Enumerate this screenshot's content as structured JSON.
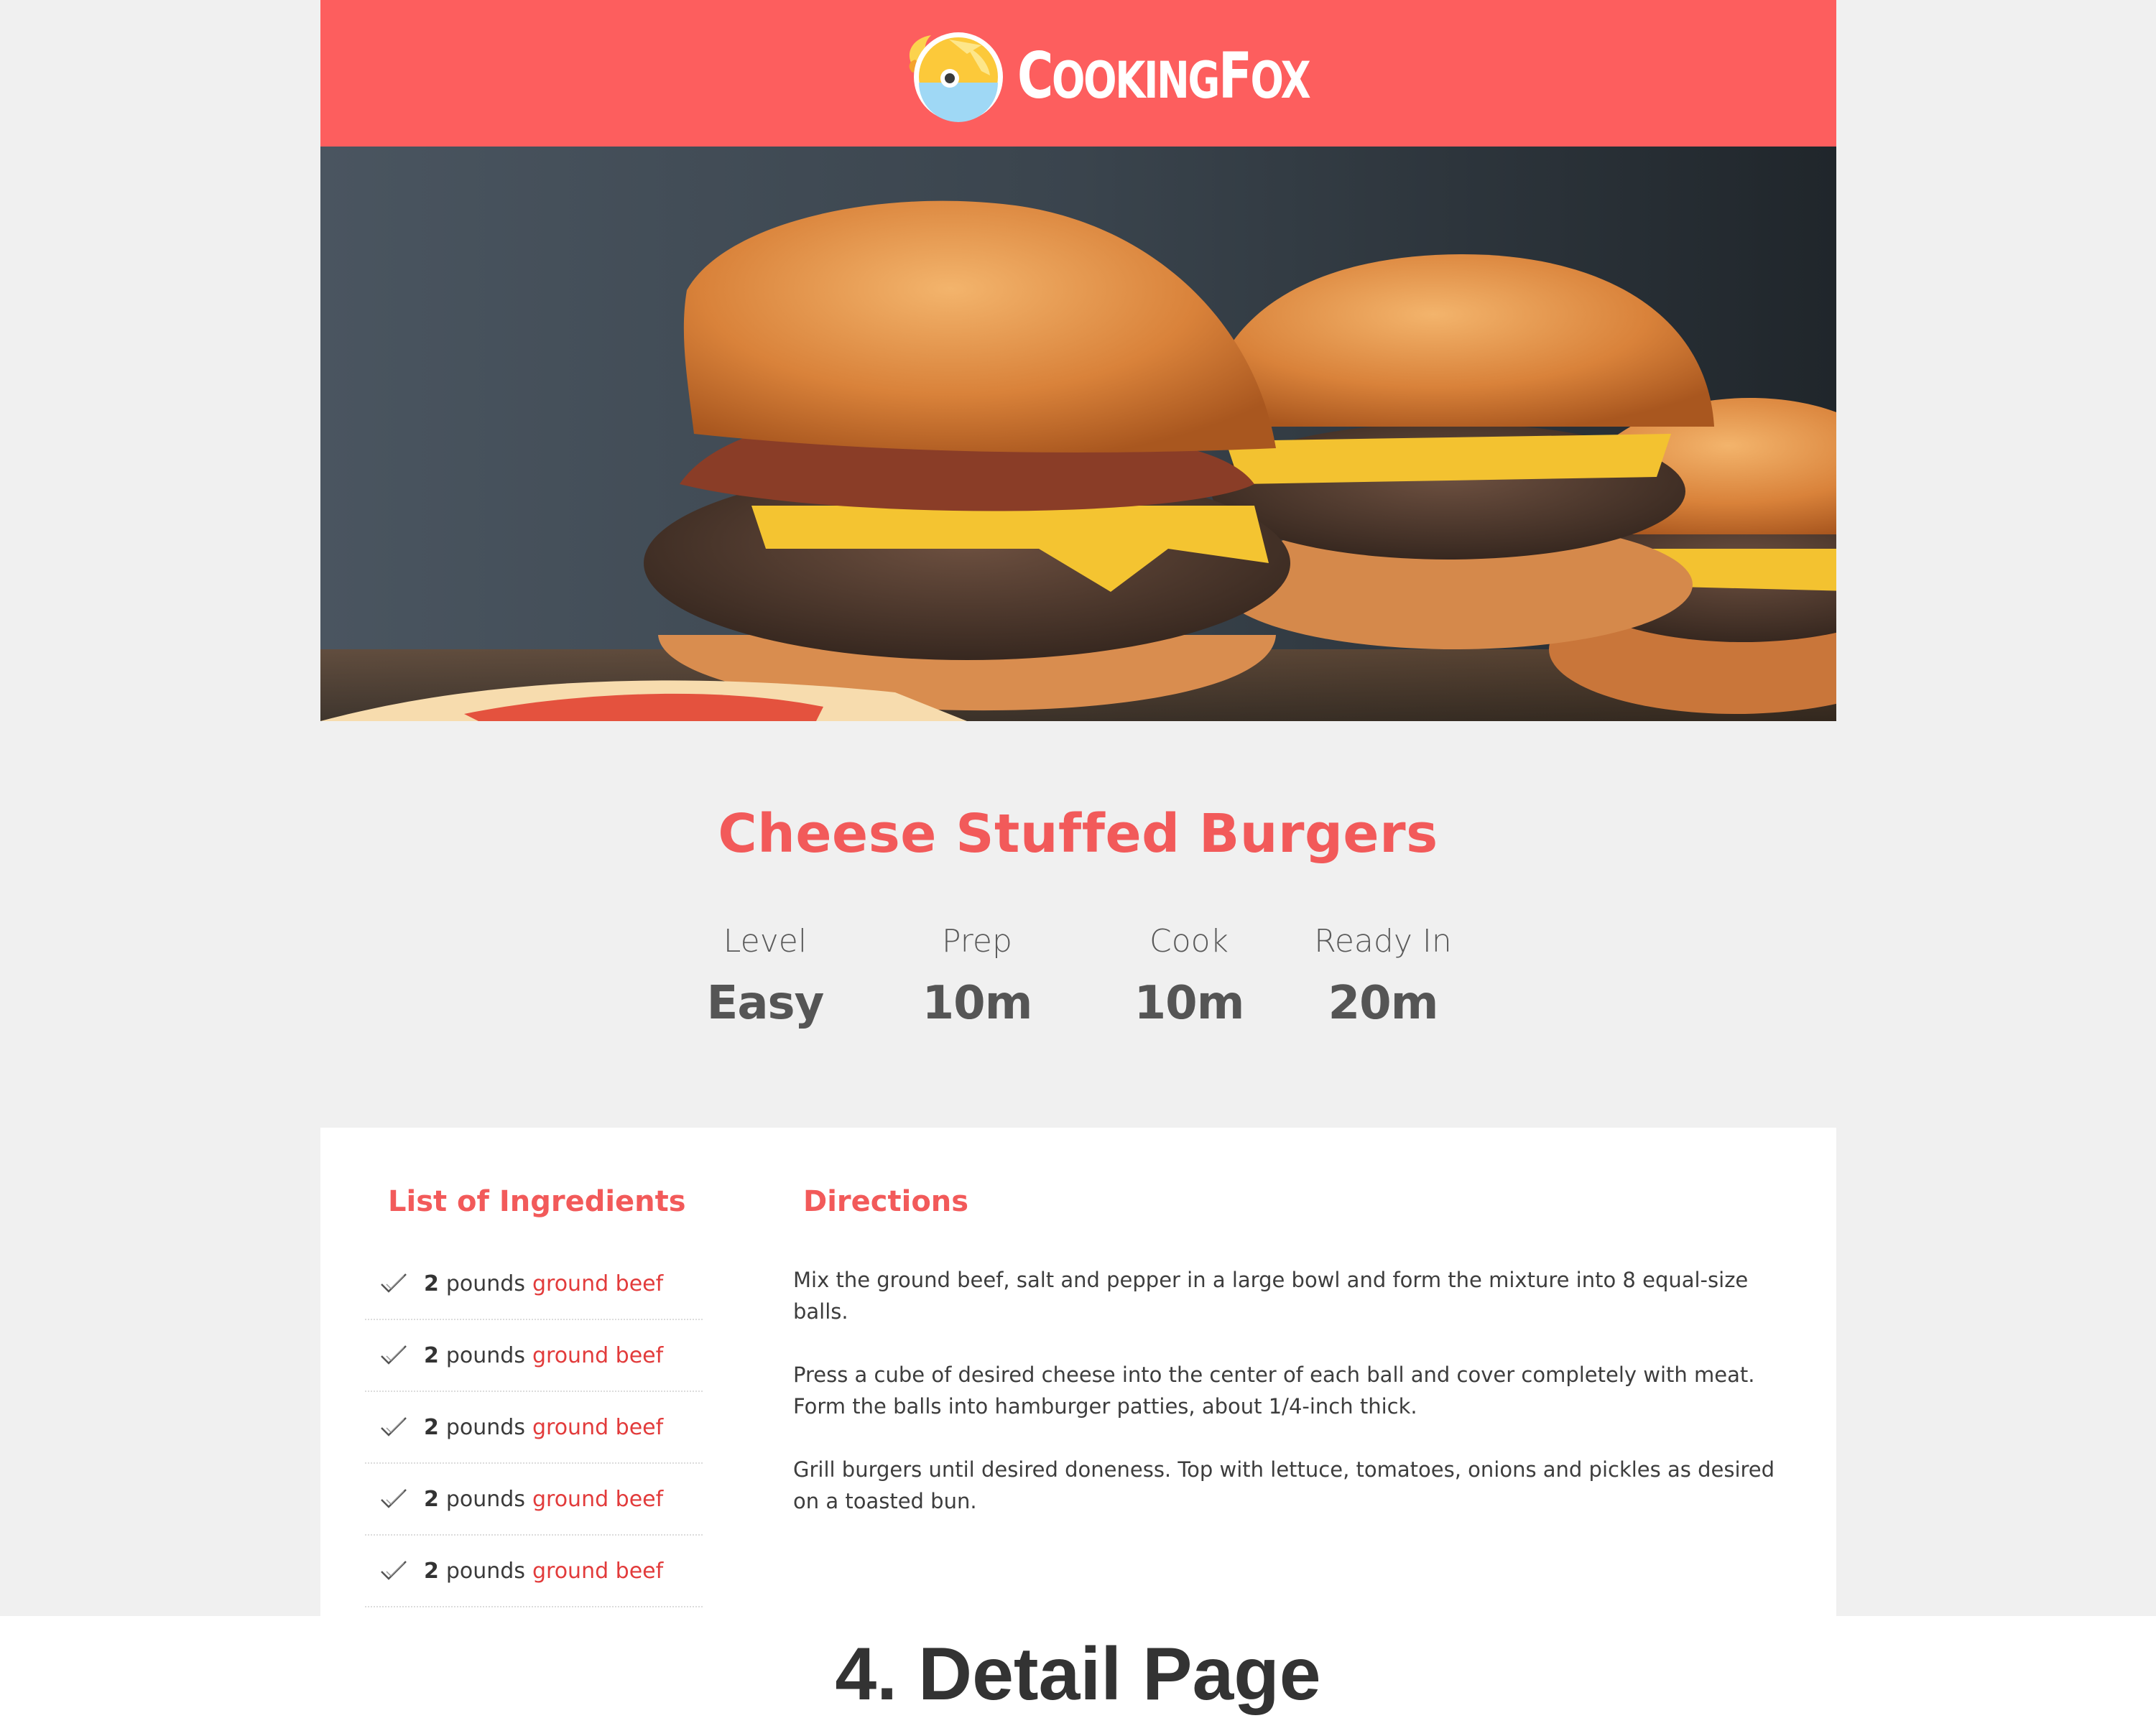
{
  "brand": {
    "name_first": "C",
    "name_rest": "OOKING",
    "name_second": "F",
    "name_second_rest": "OX",
    "color": "#fd5e5e"
  },
  "hero": {
    "image": "burger-photo"
  },
  "recipe": {
    "title": "Cheese Stuffed Burgers",
    "stats": [
      {
        "label": "Level",
        "value": "Easy"
      },
      {
        "label": "Prep",
        "value": "10m"
      },
      {
        "label": "Cook",
        "value": "10m"
      },
      {
        "label": "Ready In",
        "value": "20m"
      }
    ]
  },
  "ingredients": {
    "title": "List of Ingredients",
    "icon": "check-icon",
    "items": [
      {
        "qty": "2",
        "unit": "pounds",
        "name": "ground beef"
      },
      {
        "qty": "2",
        "unit": "pounds",
        "name": "ground beef"
      },
      {
        "qty": "2",
        "unit": "pounds",
        "name": "ground beef"
      },
      {
        "qty": "2",
        "unit": "pounds",
        "name": "ground beef"
      },
      {
        "qty": "2",
        "unit": "pounds",
        "name": "ground beef"
      }
    ]
  },
  "directions": {
    "title": "Directions",
    "steps": [
      "Mix the ground beef, salt and pepper in a large bowl and form the mixture into 8 equal-size balls.",
      "Press a cube of desired cheese into the center of each ball and cover completely with meat. Form the balls into hamburger patties, about 1/4-inch thick.",
      "Grill burgers until desired doneness. Top with lettuce, tomatoes, onions and pickles as desired on a toasted bun."
    ]
  },
  "caption": "4. Detail Page",
  "colors": {
    "accent": "#fd5e5e",
    "title": "#f25a5a",
    "link": "#e23b3b",
    "background": "#f0f0f0"
  }
}
